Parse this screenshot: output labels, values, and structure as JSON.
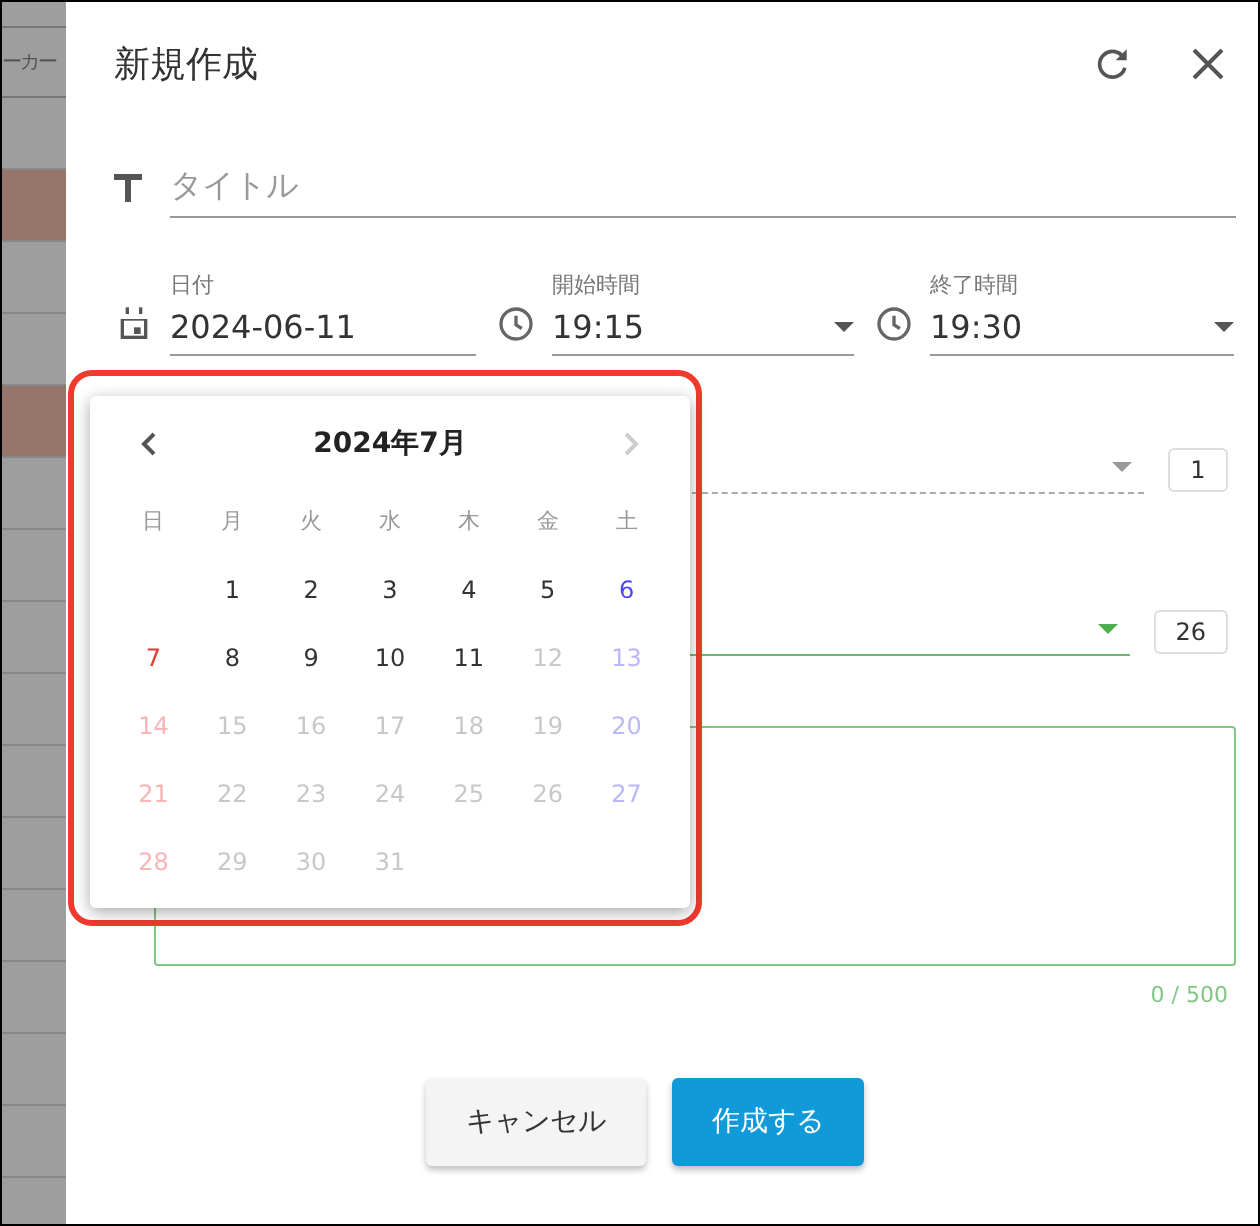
{
  "background": {
    "header_fragment": "ーカー"
  },
  "dialog": {
    "title": "新規作成",
    "title_field": {
      "placeholder": "タイトル"
    },
    "date_field": {
      "label": "日付",
      "value": "2024-06-11"
    },
    "start_time": {
      "label": "開始時間",
      "value": "19:15"
    },
    "end_time": {
      "label": "終了時間",
      "value": "19:30"
    },
    "select_rows": [
      {
        "count": "1",
        "focused": false
      },
      {
        "count": "26",
        "focused": true
      }
    ],
    "note_counter": "0 / 500",
    "buttons": [
      {
        "label": "キャンセル",
        "kind": "secondary"
      },
      {
        "label": "作成する",
        "kind": "primary"
      }
    ]
  },
  "calendar": {
    "title": "2024年7月",
    "prev_disabled": false,
    "next_disabled": true,
    "weekdays": [
      {
        "label": "日"
      },
      {
        "label": "月"
      },
      {
        "label": "火"
      },
      {
        "label": "水"
      },
      {
        "label": "木"
      },
      {
        "label": "金"
      },
      {
        "label": "土"
      }
    ],
    "weeks": [
      [
        {
          "kind": "blank"
        },
        {
          "label": "1",
          "kind": "weekday",
          "disabled": false
        },
        {
          "label": "2",
          "kind": "weekday",
          "disabled": false
        },
        {
          "label": "3",
          "kind": "weekday",
          "disabled": false
        },
        {
          "label": "4",
          "kind": "weekday",
          "disabled": false
        },
        {
          "label": "5",
          "kind": "weekday",
          "disabled": false
        },
        {
          "label": "6",
          "kind": "saturday",
          "disabled": false
        }
      ],
      [
        {
          "label": "7",
          "kind": "sunday",
          "disabled": false
        },
        {
          "label": "8",
          "kind": "weekday",
          "disabled": false
        },
        {
          "label": "9",
          "kind": "weekday",
          "disabled": false
        },
        {
          "label": "10",
          "kind": "weekday",
          "disabled": false
        },
        {
          "label": "11",
          "kind": "weekday",
          "disabled": false
        },
        {
          "label": "12",
          "kind": "weekday",
          "disabled": true
        },
        {
          "label": "13",
          "kind": "saturday",
          "disabled": true
        }
      ],
      [
        {
          "label": "14",
          "kind": "sunday",
          "disabled": true
        },
        {
          "label": "15",
          "kind": "weekday",
          "disabled": true
        },
        {
          "label": "16",
          "kind": "weekday",
          "disabled": true
        },
        {
          "label": "17",
          "kind": "weekday",
          "disabled": true
        },
        {
          "label": "18",
          "kind": "weekday",
          "disabled": true
        },
        {
          "label": "19",
          "kind": "weekday",
          "disabled": true
        },
        {
          "label": "20",
          "kind": "saturday",
          "disabled": true
        }
      ],
      [
        {
          "label": "21",
          "kind": "sunday",
          "disabled": true
        },
        {
          "label": "22",
          "kind": "weekday",
          "disabled": true
        },
        {
          "label": "23",
          "kind": "weekday",
          "disabled": true
        },
        {
          "label": "24",
          "kind": "weekday",
          "disabled": true
        },
        {
          "label": "25",
          "kind": "weekday",
          "disabled": true
        },
        {
          "label": "26",
          "kind": "weekday",
          "disabled": true
        },
        {
          "label": "27",
          "kind": "saturday",
          "disabled": true
        }
      ],
      [
        {
          "label": "28",
          "kind": "sunday",
          "disabled": true
        },
        {
          "label": "29",
          "kind": "weekday",
          "disabled": true
        },
        {
          "label": "30",
          "kind": "weekday",
          "disabled": true
        },
        {
          "label": "31",
          "kind": "weekday",
          "disabled": true
        }
      ]
    ]
  }
}
